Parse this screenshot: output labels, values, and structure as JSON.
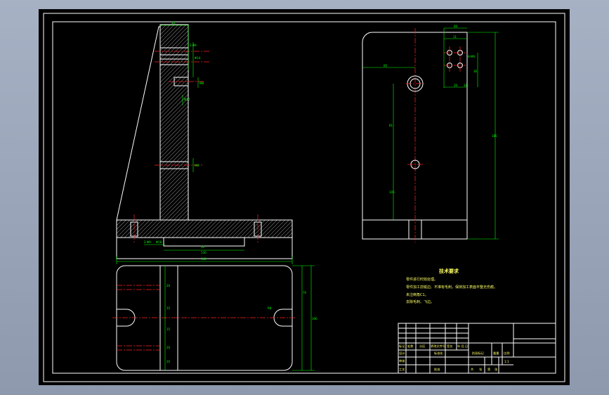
{
  "drawing": {
    "dims_side": [
      "30",
      "2-Φ9",
      "Φ14",
      "M8",
      "Φ10",
      "M8",
      "Φ18",
      "2-Φ9",
      "50",
      "130",
      "340"
    ],
    "dims_front": [
      "60",
      "60",
      "11",
      "185",
      "81",
      "105",
      "36",
      "4-M6",
      "20",
      "32"
    ],
    "dims_top": [
      "20",
      "70",
      "15",
      "190",
      "15",
      "20",
      "20",
      "R8"
    ],
    "tech_title": "技术要求",
    "tech_notes": [
      "零件进行时效处理。",
      "零件加工前锐边、不准有毛刺，保持加工表面平整无伤痕。",
      "未注倒角C1。",
      "去除毛刺、飞边。"
    ],
    "titleblock": {
      "r1": [
        "标记",
        "处数",
        "分区",
        "更改文件号",
        "签名",
        "年.月.日"
      ],
      "r2": [
        "设计",
        "",
        "标准化"
      ],
      "r3": [
        "审核",
        ""
      ],
      "r4": [
        "工艺",
        "",
        "批准"
      ],
      "stage": "阶段标记",
      "weight": "重量",
      "scale": "比例",
      "ratio": "1:1",
      "sheet": [
        "共",
        "张",
        "第",
        "张"
      ]
    }
  }
}
